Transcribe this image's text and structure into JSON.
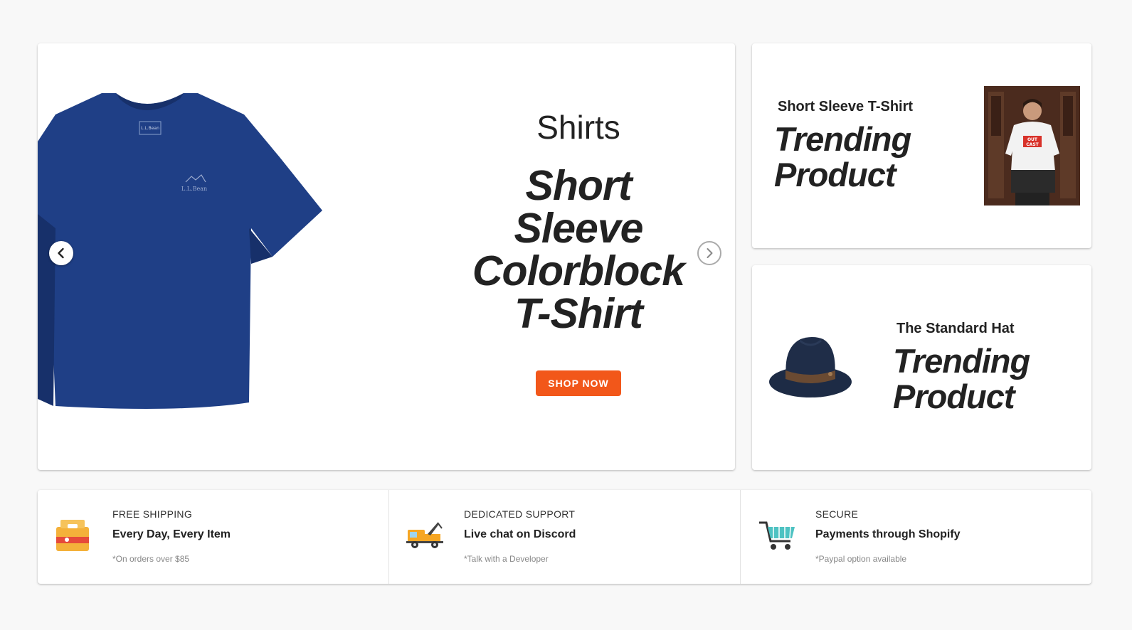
{
  "hero": {
    "category": "Shirts",
    "title_lines": [
      "Short",
      "Sleeve",
      "Colorblock",
      "T-Shirt"
    ],
    "shirt_logo": "L.L.Bean",
    "cta_label": "SHOP NOW",
    "prev_icon": "chevron-left-icon",
    "next_icon": "chevron-right-icon"
  },
  "trending": [
    {
      "subtitle": "Short Sleeve T-Shirt",
      "title_lines": [
        "Trending",
        "Product"
      ],
      "shirt_print": [
        "OUT",
        "CAST"
      ]
    },
    {
      "subtitle": "The Standard Hat",
      "title_lines": [
        "Trending",
        "Product"
      ]
    }
  ],
  "features": [
    {
      "icon": "package-icon",
      "label": "FREE SHIPPING",
      "main": "Every Day, Every Item",
      "note": "*On orders over $85"
    },
    {
      "icon": "tow-truck-icon",
      "label": "DEDICATED SUPPORT",
      "main": "Live chat on Discord",
      "note": "*Talk with a Developer"
    },
    {
      "icon": "shopping-cart-icon",
      "label": "SECURE",
      "main": "Payments through Shopify",
      "note": "*Paypal option available"
    }
  ],
  "colors": {
    "accent": "#f2571a",
    "background": "#f8f8f8",
    "text": "#222222",
    "shirt": "#1f3f86"
  }
}
